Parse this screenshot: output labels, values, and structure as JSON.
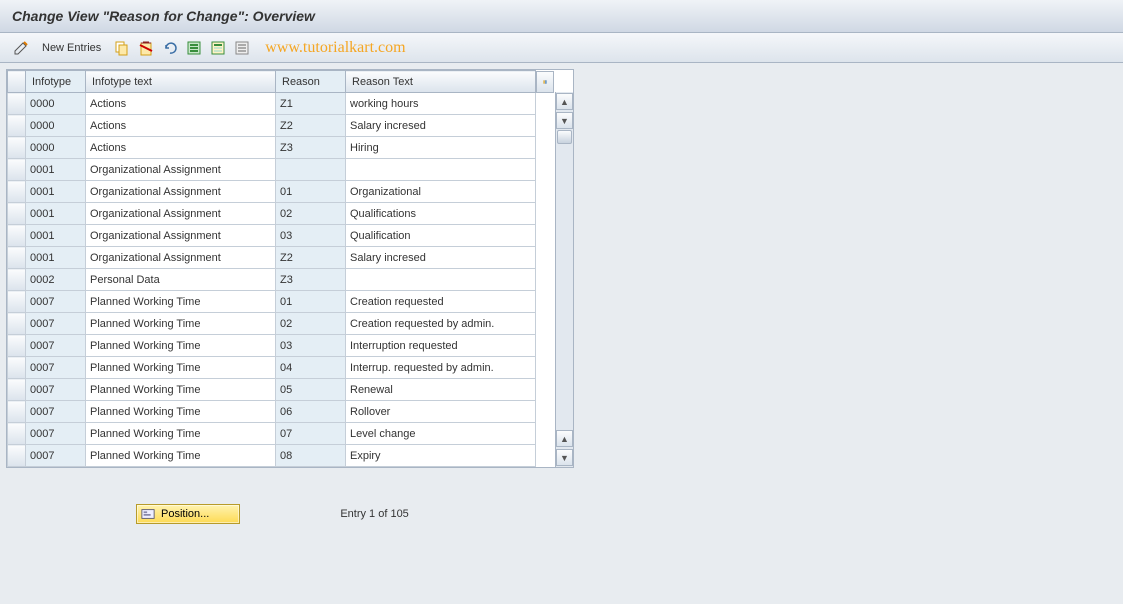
{
  "header": {
    "title": "Change View \"Reason for Change\": Overview"
  },
  "toolbar": {
    "new_entries_label": "New Entries",
    "watermark": "www.tutorialkart.com"
  },
  "table": {
    "headers": {
      "infotype": "Infotype",
      "infotext": "Infotype text",
      "reason": "Reason",
      "reasontext": "Reason Text"
    },
    "rows": [
      {
        "infotype": "0000",
        "infotext": "Actions",
        "reason": "Z1",
        "reasontext": "working hours"
      },
      {
        "infotype": "0000",
        "infotext": "Actions",
        "reason": "Z2",
        "reasontext": "Salary incresed"
      },
      {
        "infotype": "0000",
        "infotext": "Actions",
        "reason": "Z3",
        "reasontext": "Hiring"
      },
      {
        "infotype": "0001",
        "infotext": "Organizational Assignment",
        "reason": "",
        "reasontext": ""
      },
      {
        "infotype": "0001",
        "infotext": "Organizational Assignment",
        "reason": "01",
        "reasontext": "Organizational"
      },
      {
        "infotype": "0001",
        "infotext": "Organizational Assignment",
        "reason": "02",
        "reasontext": "Qualifications"
      },
      {
        "infotype": "0001",
        "infotext": "Organizational Assignment",
        "reason": "03",
        "reasontext": "Qualification"
      },
      {
        "infotype": "0001",
        "infotext": "Organizational Assignment",
        "reason": "Z2",
        "reasontext": "Salary incresed"
      },
      {
        "infotype": "0002",
        "infotext": "Personal Data",
        "reason": "Z3",
        "reasontext": ""
      },
      {
        "infotype": "0007",
        "infotext": "Planned Working Time",
        "reason": "01",
        "reasontext": "Creation requested"
      },
      {
        "infotype": "0007",
        "infotext": "Planned Working Time",
        "reason": "02",
        "reasontext": "Creation requested by admin."
      },
      {
        "infotype": "0007",
        "infotext": "Planned Working Time",
        "reason": "03",
        "reasontext": "Interruption requested"
      },
      {
        "infotype": "0007",
        "infotext": "Planned Working Time",
        "reason": "04",
        "reasontext": "Interrup. requested by admin."
      },
      {
        "infotype": "0007",
        "infotext": "Planned Working Time",
        "reason": "05",
        "reasontext": "Renewal"
      },
      {
        "infotype": "0007",
        "infotext": "Planned Working Time",
        "reason": "06",
        "reasontext": "Rollover"
      },
      {
        "infotype": "0007",
        "infotext": "Planned Working Time",
        "reason": "07",
        "reasontext": "Level change"
      },
      {
        "infotype": "0007",
        "infotext": "Planned Working Time",
        "reason": "08",
        "reasontext": "Expiry"
      }
    ]
  },
  "footer": {
    "position_label": "Position...",
    "entry_counter": "Entry 1 of 105"
  }
}
